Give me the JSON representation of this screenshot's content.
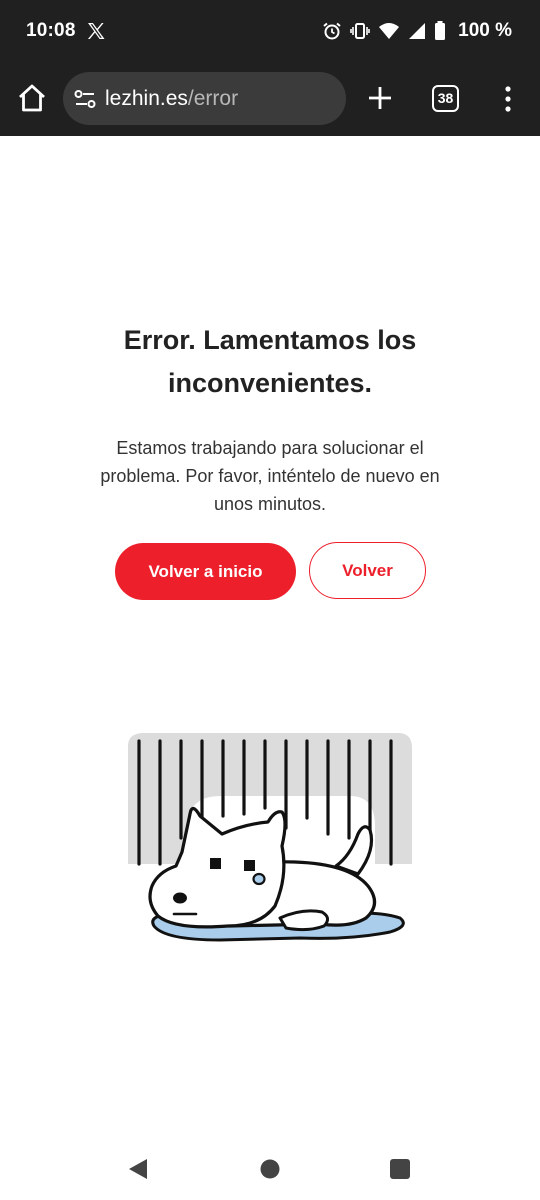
{
  "status_bar": {
    "time": "10:08",
    "battery": "100 %",
    "icons": [
      "x-logo-icon",
      "alarm-icon",
      "vibrate-icon",
      "wifi-icon",
      "signal-icon",
      "battery-icon"
    ]
  },
  "browser": {
    "url_domain": "lezhin.es",
    "url_path": "/error",
    "tab_count": "38",
    "icons": [
      "home-icon",
      "site-settings-icon",
      "plus-icon",
      "more-vert-icon"
    ]
  },
  "page": {
    "title": "Error. Lamentamos los inconvenientes.",
    "message": "Estamos trabajando para solucionar el problema. Por favor, inténtelo de nuevo en unos minutos.",
    "primary_button": "Volver a inicio",
    "secondary_button": "Volver",
    "illustration": "sad-dog-in-rain-illustration"
  },
  "colors": {
    "accent": "#ec1f2b",
    "bar_background": "#202020",
    "url_box": "#3b3b3b"
  },
  "nav_bar": {
    "icons": [
      "back-triangle-icon",
      "home-circle-icon",
      "recents-square-icon"
    ]
  }
}
